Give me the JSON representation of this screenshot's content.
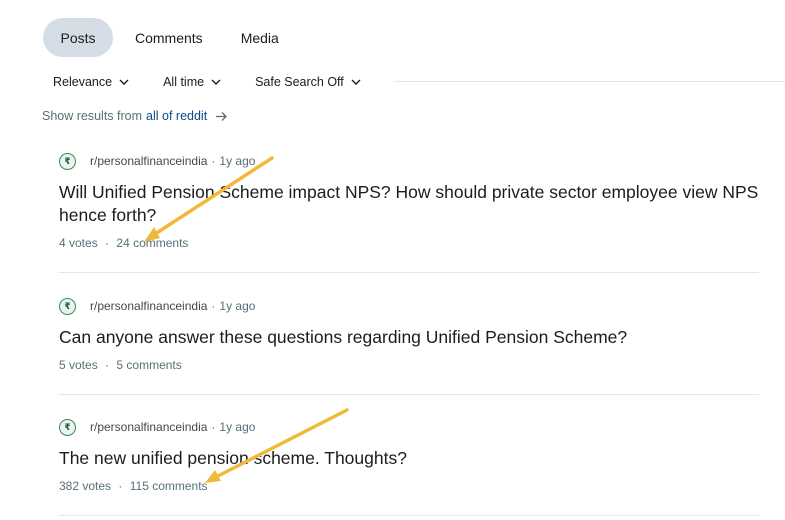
{
  "tabs": [
    {
      "label": "Posts",
      "active": true
    },
    {
      "label": "Comments",
      "active": false
    },
    {
      "label": "Media",
      "active": false
    }
  ],
  "filters": [
    {
      "label": "Relevance"
    },
    {
      "label": "All time"
    },
    {
      "label": "Safe Search Off"
    }
  ],
  "show_results": {
    "prefix": "Show results from",
    "link": "all of reddit"
  },
  "posts": [
    {
      "subreddit": "r/personalfinanceindia",
      "age": "1y ago",
      "title": "Will Unified Pension Scheme impact NPS? How should private sector employee view NPS hence forth?",
      "votes": "4 votes",
      "comments": "24 comments"
    },
    {
      "subreddit": "r/personalfinanceindia",
      "age": "1y ago",
      "title": "Can anyone answer these questions regarding Unified Pension Scheme?",
      "votes": "5 votes",
      "comments": "5 comments"
    },
    {
      "subreddit": "r/personalfinanceindia",
      "age": "1y ago",
      "title": "The new unified pension scheme. Thoughts?",
      "votes": "382 votes",
      "comments": "115 comments"
    }
  ],
  "icons": {
    "subreddit": "subreddit-rupee-icon",
    "chevron": "chevron-down-icon",
    "arrow": "arrow-right-icon"
  },
  "colors": {
    "active_tab_bg": "#d5dee6",
    "link": "#0a4b8c",
    "annotation_arrow": "#f0b93a"
  }
}
